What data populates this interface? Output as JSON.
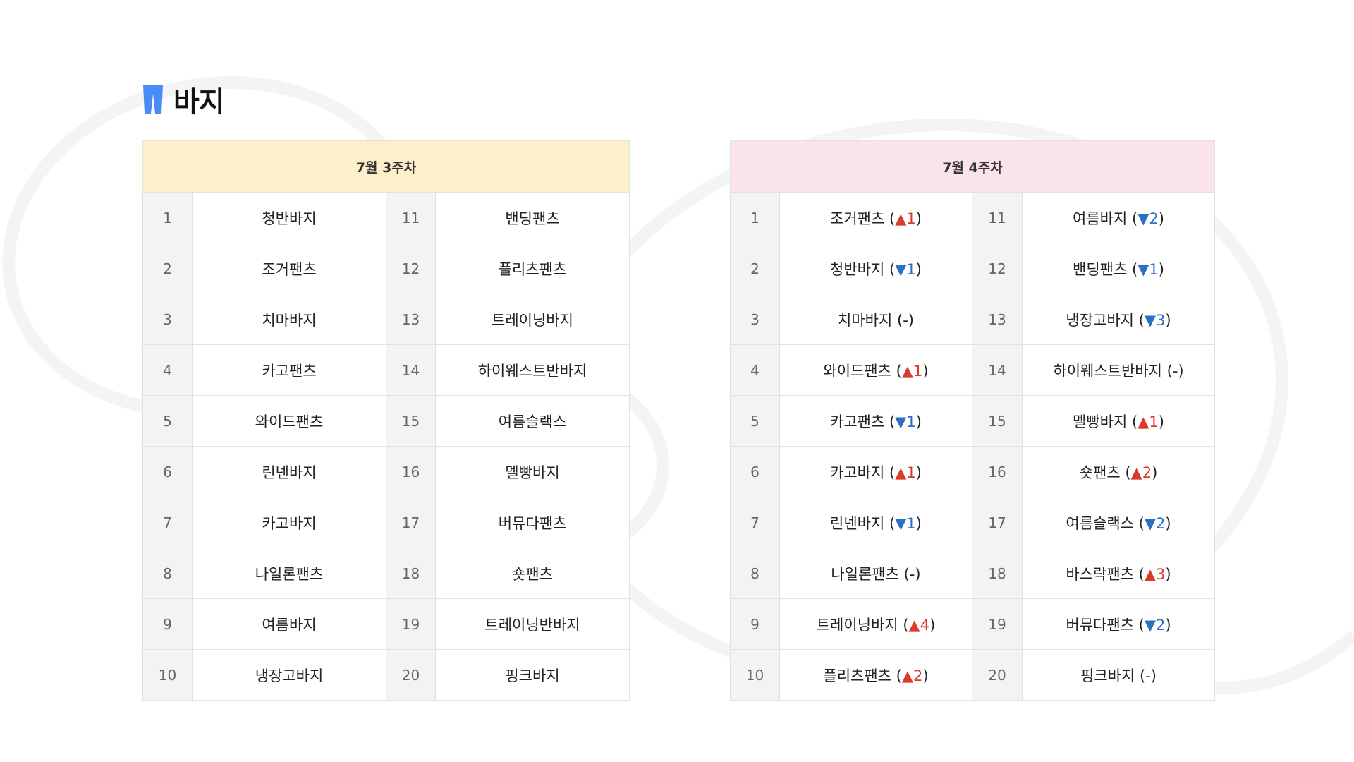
{
  "section": {
    "title": "바지",
    "icon": "pants-icon",
    "accent": "#4a8cf7"
  },
  "colors": {
    "up": "#d93a2b",
    "down": "#2d6fc4",
    "week1_header_bg": "#fcefca",
    "week2_header_bg": "#fbe3ee"
  },
  "tables": [
    {
      "week": "7월 3주차",
      "rows": [
        {
          "left": {
            "rank": "1",
            "name": "청반바지"
          },
          "right": {
            "rank": "11",
            "name": "밴딩팬츠"
          }
        },
        {
          "left": {
            "rank": "2",
            "name": "조거팬츠"
          },
          "right": {
            "rank": "12",
            "name": "플리츠팬츠"
          }
        },
        {
          "left": {
            "rank": "3",
            "name": "치마바지"
          },
          "right": {
            "rank": "13",
            "name": "트레이닝바지"
          }
        },
        {
          "left": {
            "rank": "4",
            "name": "카고팬츠"
          },
          "right": {
            "rank": "14",
            "name": "하이웨스트반바지"
          }
        },
        {
          "left": {
            "rank": "5",
            "name": "와이드팬츠"
          },
          "right": {
            "rank": "15",
            "name": "여름슬랙스"
          }
        },
        {
          "left": {
            "rank": "6",
            "name": "린넨바지"
          },
          "right": {
            "rank": "16",
            "name": "멜빵바지"
          }
        },
        {
          "left": {
            "rank": "7",
            "name": "카고바지"
          },
          "right": {
            "rank": "17",
            "name": "버뮤다팬츠"
          }
        },
        {
          "left": {
            "rank": "8",
            "name": "나일론팬츠"
          },
          "right": {
            "rank": "18",
            "name": "숏팬츠"
          }
        },
        {
          "left": {
            "rank": "9",
            "name": "여름바지"
          },
          "right": {
            "rank": "19",
            "name": "트레이닝반바지"
          }
        },
        {
          "left": {
            "rank": "10",
            "name": "냉장고바지"
          },
          "right": {
            "rank": "20",
            "name": "핑크바지"
          }
        }
      ]
    },
    {
      "week": "7월 4주차",
      "rows": [
        {
          "left": {
            "rank": "1",
            "name": "조거팬츠",
            "dir": "up",
            "change": "1"
          },
          "right": {
            "rank": "11",
            "name": "여름바지",
            "dir": "down",
            "change": "2"
          }
        },
        {
          "left": {
            "rank": "2",
            "name": "청반바지",
            "dir": "down",
            "change": "1"
          },
          "right": {
            "rank": "12",
            "name": "밴딩팬츠",
            "dir": "down",
            "change": "1"
          }
        },
        {
          "left": {
            "rank": "3",
            "name": "치마바지",
            "dir": "same",
            "change": "-"
          },
          "right": {
            "rank": "13",
            "name": "냉장고바지",
            "dir": "down",
            "change": "3"
          }
        },
        {
          "left": {
            "rank": "4",
            "name": "와이드팬츠",
            "dir": "up",
            "change": "1"
          },
          "right": {
            "rank": "14",
            "name": "하이웨스트반바지",
            "dir": "same",
            "change": "-"
          }
        },
        {
          "left": {
            "rank": "5",
            "name": "카고팬츠",
            "dir": "down",
            "change": "1"
          },
          "right": {
            "rank": "15",
            "name": "멜빵바지",
            "dir": "up",
            "change": "1"
          }
        },
        {
          "left": {
            "rank": "6",
            "name": "카고바지",
            "dir": "up",
            "change": "1"
          },
          "right": {
            "rank": "16",
            "name": "숏팬츠",
            "dir": "up",
            "change": "2"
          }
        },
        {
          "left": {
            "rank": "7",
            "name": "린넨바지",
            "dir": "down",
            "change": "1"
          },
          "right": {
            "rank": "17",
            "name": "여름슬랙스",
            "dir": "down",
            "change": "2"
          }
        },
        {
          "left": {
            "rank": "8",
            "name": "나일론팬츠",
            "dir": "same",
            "change": "-"
          },
          "right": {
            "rank": "18",
            "name": "바스락팬츠",
            "dir": "up",
            "change": "3"
          }
        },
        {
          "left": {
            "rank": "9",
            "name": "트레이닝바지",
            "dir": "up",
            "change": "4"
          },
          "right": {
            "rank": "19",
            "name": "버뮤다팬츠",
            "dir": "down",
            "change": "2"
          }
        },
        {
          "left": {
            "rank": "10",
            "name": "플리츠팬츠",
            "dir": "up",
            "change": "2"
          },
          "right": {
            "rank": "20",
            "name": "핑크바지",
            "dir": "same",
            "change": "-"
          }
        }
      ]
    }
  ]
}
